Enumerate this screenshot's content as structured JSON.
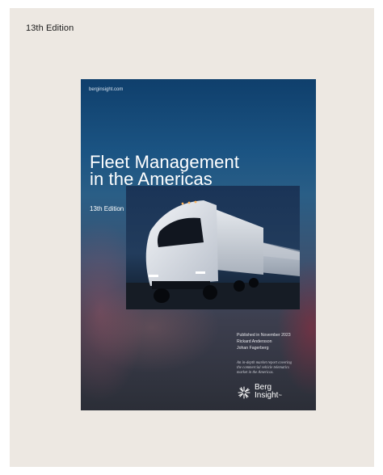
{
  "page": {
    "edition_label": "13th Edition"
  },
  "cover": {
    "website": "berginsight.com",
    "title_line1": "Fleet Management",
    "title_line2": "in the Americas",
    "edition": "13th Edition",
    "published": "Published in November 2023",
    "author1": "Rickard Andersson",
    "author2": "Johan Fagerberg",
    "blurb_line1": "An in-depth market report covering",
    "blurb_line2": "the commercial vehicle telematics",
    "blurb_line3": "market in the Americas.",
    "logo_line1": "Berg",
    "logo_line2": "Insight",
    "logo_tm": "™"
  },
  "colors": {
    "background": "#ede8e2",
    "cover_top": "#0f3f6c",
    "cover_bottom": "#2b2e37"
  },
  "icons": [
    "berg-insight-logo-icon"
  ]
}
